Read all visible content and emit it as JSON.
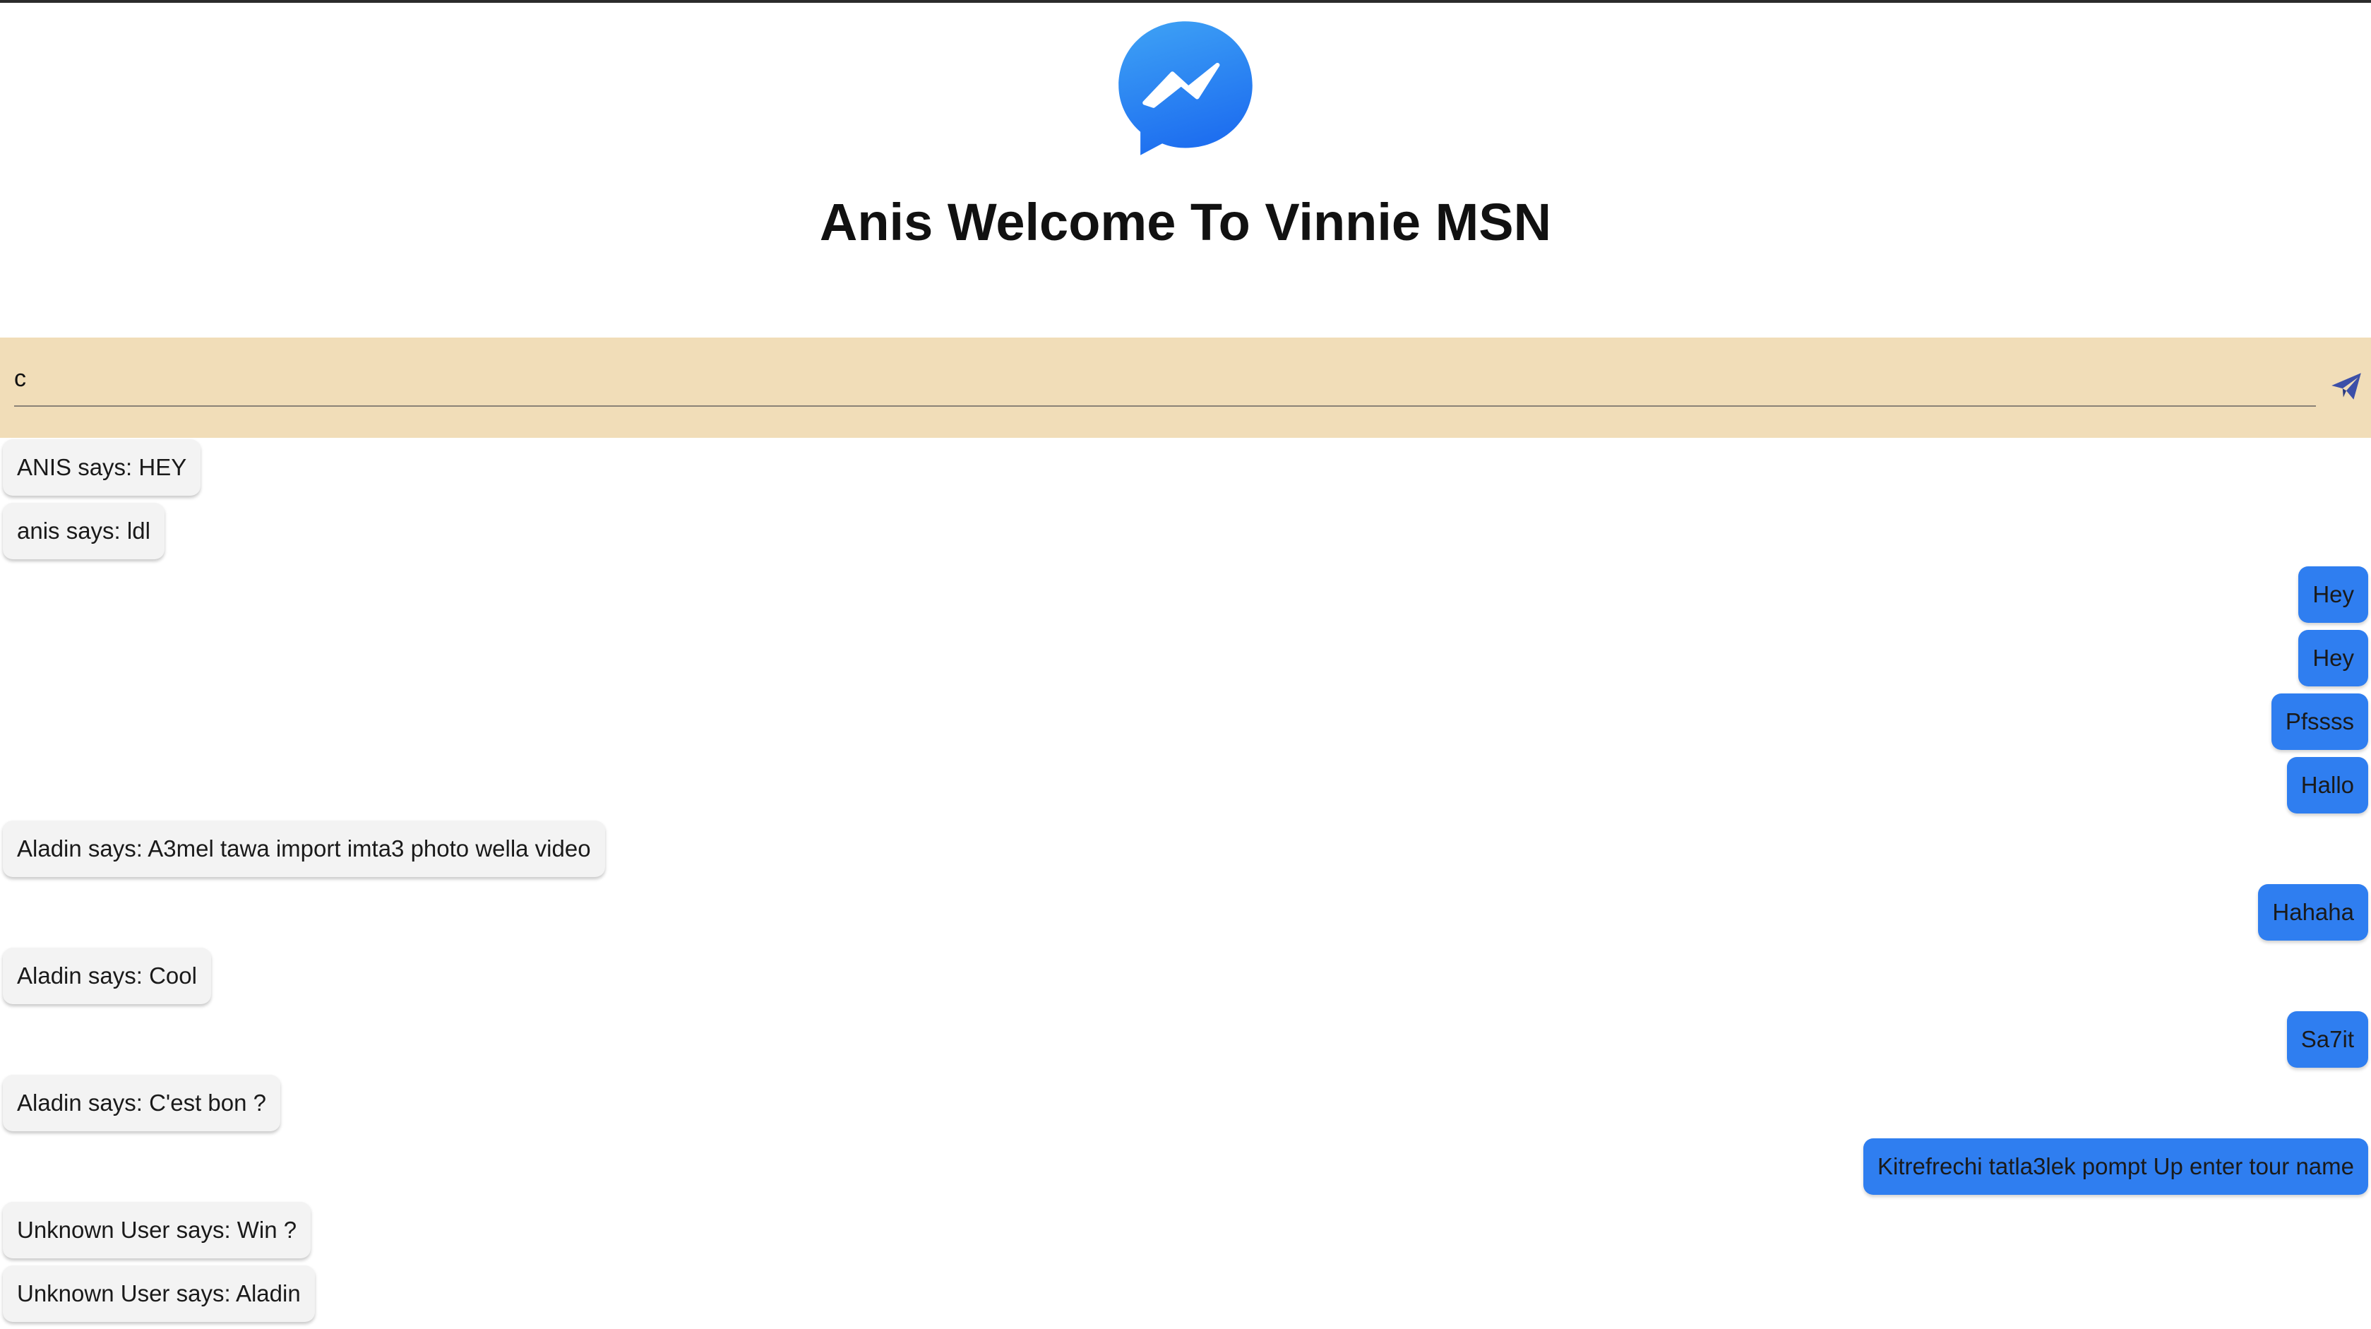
{
  "header": {
    "title": "Anis Welcome To Vinnie MSN",
    "logo_icon": "messenger-icon"
  },
  "composer": {
    "value": "c",
    "send_icon": "paper-plane-icon"
  },
  "colors": {
    "composer_bg": "#f1ddb8",
    "outgoing_bubble": "#2f7ef0",
    "incoming_bubble": "#f3f3f3",
    "send_icon": "#3c4fa8"
  },
  "messages": [
    {
      "text": "ANIS says: HEY",
      "direction": "incoming"
    },
    {
      "text": "anis says: ldl",
      "direction": "incoming"
    },
    {
      "text": "Hey",
      "direction": "outgoing"
    },
    {
      "text": "Hey",
      "direction": "outgoing"
    },
    {
      "text": "Pfssss",
      "direction": "outgoing"
    },
    {
      "text": "Hallo",
      "direction": "outgoing"
    },
    {
      "text": "Aladin says: A3mel tawa import imta3 photo wella video",
      "direction": "incoming"
    },
    {
      "text": "Hahaha",
      "direction": "outgoing"
    },
    {
      "text": "Aladin says: Cool",
      "direction": "incoming"
    },
    {
      "text": "Sa7it",
      "direction": "outgoing"
    },
    {
      "text": "Aladin says: C'est bon ?",
      "direction": "incoming"
    },
    {
      "text": "Kitrefrechi tatla3lek pompt Up enter tour name",
      "direction": "outgoing"
    },
    {
      "text": "Unknown User says: Win ?",
      "direction": "incoming"
    },
    {
      "text": "Unknown User says: Aladin",
      "direction": "incoming"
    }
  ]
}
